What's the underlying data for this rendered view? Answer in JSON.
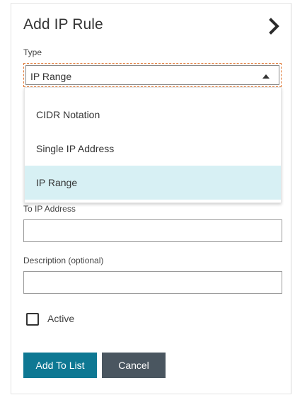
{
  "panel": {
    "title": "Add IP Rule",
    "collapse_icon": "chevron-right-icon"
  },
  "type_field": {
    "label": "Type",
    "selected_value": "IP Range",
    "caret_icon": "caret-up-icon",
    "options": [
      {
        "label": "CIDR Notation",
        "selected": false
      },
      {
        "label": "Single IP Address",
        "selected": false
      },
      {
        "label": "IP Range",
        "selected": true
      }
    ]
  },
  "to_ip_field": {
    "label": "To IP Address",
    "value": ""
  },
  "description_field": {
    "label": "Description (optional)",
    "value": ""
  },
  "active_checkbox": {
    "label": "Active",
    "checked": false
  },
  "buttons": {
    "add_label": "Add To List",
    "cancel_label": "Cancel"
  },
  "colors": {
    "primary": "#0e7893",
    "secondary": "#4a5660",
    "selected_option": "#d7f0f4",
    "focus_outline": "#e07b39"
  }
}
